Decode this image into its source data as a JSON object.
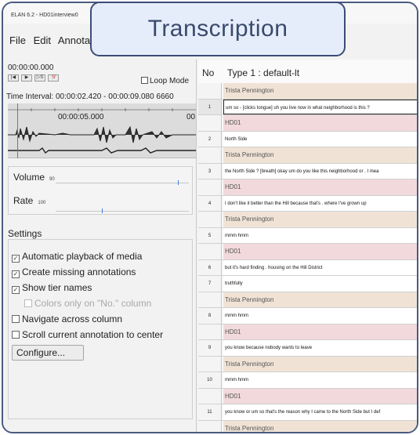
{
  "window": {
    "title": "ELAN 6.2 - HD01interview0"
  },
  "menu": {
    "items": [
      "File",
      "Edit",
      "Annota"
    ]
  },
  "overlay": {
    "label": "Transcription"
  },
  "player": {
    "timecode": "00:00:00.000",
    "loop_label": "Loop Mode",
    "interval": "Time Interval: 00:00:02.420 - 00:00:09.080  6660",
    "wave_tick": "00:00:05.000",
    "wave_tick_right": "00"
  },
  "sliders": {
    "volume_label": "Volume",
    "volume_value": "90",
    "rate_label": "Rate",
    "rate_value": "100"
  },
  "settings": {
    "title": "Settings",
    "items": [
      {
        "label": "Automatic playback of media",
        "checked": true
      },
      {
        "label": "Create missing annotations",
        "checked": true
      },
      {
        "label": "Show tier names",
        "checked": true
      },
      {
        "label": "Colors only on \"No.\" column",
        "checked": false,
        "disabled": true
      },
      {
        "label": "Navigate across column",
        "checked": false
      },
      {
        "label": "Scroll current annotation to center",
        "checked": false
      }
    ],
    "configure_label": "Configure..."
  },
  "table": {
    "header_no": "No",
    "header_tier": "Type 1 : default-lt",
    "rows": [
      {
        "kind": "tp",
        "no": "",
        "text": "Trista Pennington"
      },
      {
        "kind": "ann",
        "no": "1",
        "text": "um so - [clicks tongue] uh you live now in what neighborhood is this ?",
        "selected": true
      },
      {
        "kind": "hd",
        "no": "",
        "text": "HD01"
      },
      {
        "kind": "ann",
        "no": "2",
        "text": "North Side"
      },
      {
        "kind": "tp",
        "no": "",
        "text": "Trista Pennington"
      },
      {
        "kind": "ann",
        "no": "3",
        "text": "the North Side ? [breath]  okay um do you like this neighborhood or . I mea"
      },
      {
        "kind": "hd",
        "no": "",
        "text": "HD01"
      },
      {
        "kind": "ann",
        "no": "4",
        "text": "I don't like it better than the Hill because that's . where I've grown up"
      },
      {
        "kind": "tp",
        "no": "",
        "text": "Trista Pennington"
      },
      {
        "kind": "ann",
        "no": "5",
        "text": "mmm hmm"
      },
      {
        "kind": "hd",
        "no": "",
        "text": "HD01"
      },
      {
        "kind": "ann",
        "no": "6",
        "text": "but it's hard finding . housing on the Hill District"
      },
      {
        "kind": "ann",
        "no": "7",
        "text": "truthfully"
      },
      {
        "kind": "tp",
        "no": "",
        "text": "Trista Pennington"
      },
      {
        "kind": "ann",
        "no": "8",
        "text": "mmm hmm"
      },
      {
        "kind": "hd",
        "no": "",
        "text": "HD01"
      },
      {
        "kind": "ann",
        "no": "9",
        "text": "you know because nobody wants to leave"
      },
      {
        "kind": "tp",
        "no": "",
        "text": "Trista Pennington"
      },
      {
        "kind": "ann",
        "no": "10",
        "text": "mmm hmm"
      },
      {
        "kind": "hd",
        "no": "",
        "text": "HD01"
      },
      {
        "kind": "ann",
        "no": "11",
        "text": "you know or um so that's the reason why I came to the North Side but I def"
      },
      {
        "kind": "tp",
        "no": "",
        "text": "Trista Pennington"
      }
    ]
  }
}
